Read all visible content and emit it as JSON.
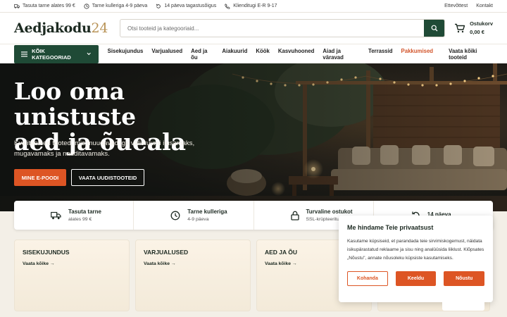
{
  "topbar": {
    "promos": [
      {
        "icon": "truck-icon",
        "label": "Tasuta tarne alates 99 €"
      },
      {
        "icon": "clock-icon",
        "label": "Tarne kulleriga 4-9 päeva"
      },
      {
        "icon": "return-icon",
        "label": "14 päeva tagastusõigus"
      },
      {
        "icon": "phone-icon",
        "label": "Klienditugi E-R 9-17"
      }
    ],
    "links": [
      "Ettevõttest",
      "Kontakt"
    ]
  },
  "header": {
    "logo_text": "Aedjakodu",
    "logo_number": "24",
    "search_placeholder": "Otsi tooteid ja kategooriaid...",
    "cart_label": "Ostukorv",
    "cart_total": "0,00 €"
  },
  "nav": {
    "all_categories": "KÕIK KATEGOORIAD",
    "items": [
      "Sisekujundus",
      "Varjualused",
      "Aed ja õu",
      "Aiakuurid",
      "Köök",
      "Kasvuhooned",
      "Aiad ja väravad",
      "Terrassid"
    ],
    "hot_item": "Pakkumised",
    "all_products": "Vaata kõiki tooteid"
  },
  "hero": {
    "title_line1": "Loo oma unistuste",
    "title_line2": "aed ja õueala",
    "text": "Kvaliteetsed tooted, mis muudavad iga välisruumi ilusamaks, mugavamaks ja nauditavamaks.",
    "primary_button": "MINE E-POODI",
    "secondary_button": "VAATA UUDISTOOTEID"
  },
  "features": [
    {
      "icon": "truck-icon",
      "title": "Tasuta tarne",
      "subtitle": "alates 99 €"
    },
    {
      "icon": "clock-icon",
      "title": "Tarne kulleriga",
      "subtitle": "4-9 päeva"
    },
    {
      "icon": "lock-icon",
      "title": "Turvaline ostukot",
      "subtitle": "SSL-krüpteeritud"
    },
    {
      "icon": "return-icon",
      "title": "14 päeva",
      "subtitle": ""
    }
  ],
  "categories": [
    {
      "name": "SISEKUJUNDUS",
      "link": "Vaata kõike"
    },
    {
      "name": "VARJUALUSED",
      "link": "Vaata kõike"
    },
    {
      "name": "AED JA ÕU",
      "link": "Vaata kõike"
    }
  ],
  "cookie": {
    "title": "Me hindame Teie privaatsust",
    "body": "Kasutame küpsiseid, et parandada teie sirvimiskogemust, näidata isikupärastatud reklaame ja sisu ning analüüsida liiklust. Klõpsates „Nõustu\", annate nõusoleku küpsiste kasutamiseks.",
    "customize": "Kohanda",
    "decline": "Keeldu",
    "accept": "Nõustu"
  },
  "colors": {
    "brand_green": "#1f4a36",
    "accent_orange": "#dd5524",
    "logo_gold": "#b99458"
  }
}
